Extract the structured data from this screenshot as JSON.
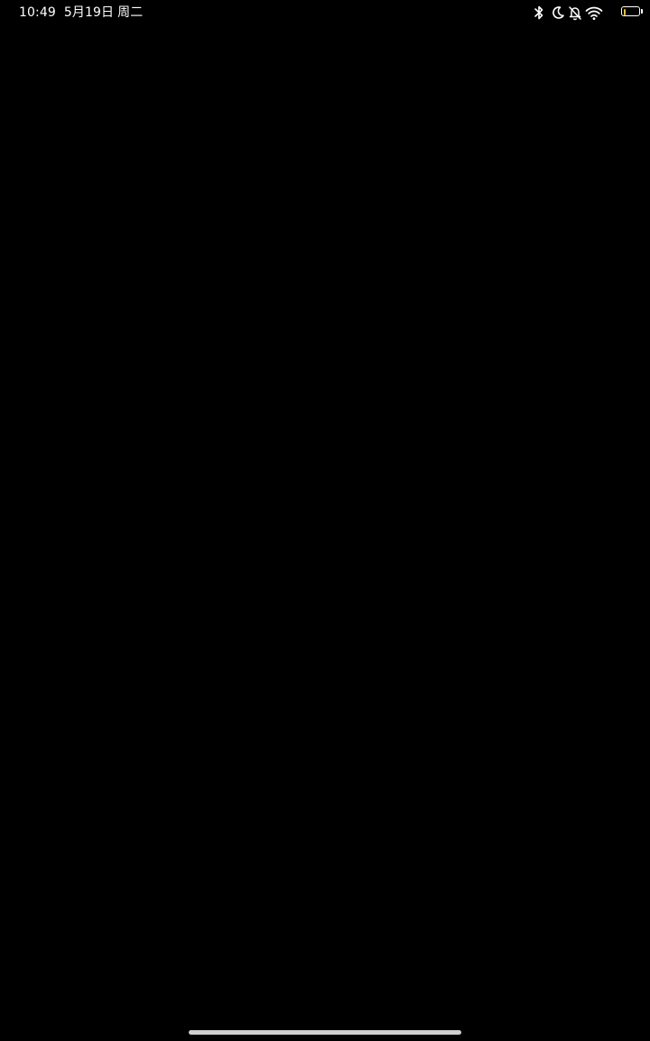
{
  "status_bar": {
    "time": "10:49",
    "date": "5月19日",
    "weekday": "周二",
    "icons": [
      "bluetooth-icon",
      "do-not-disturb-moon-icon",
      "silent-bell-icon",
      "wifi-icon",
      "battery-icon"
    ],
    "battery": {
      "level_text": "3",
      "fill_color": "#f3c318"
    }
  },
  "colors": {
    "background": "#000000",
    "foreground": "#ffffff",
    "home_indicator": "#cfcfcf"
  }
}
